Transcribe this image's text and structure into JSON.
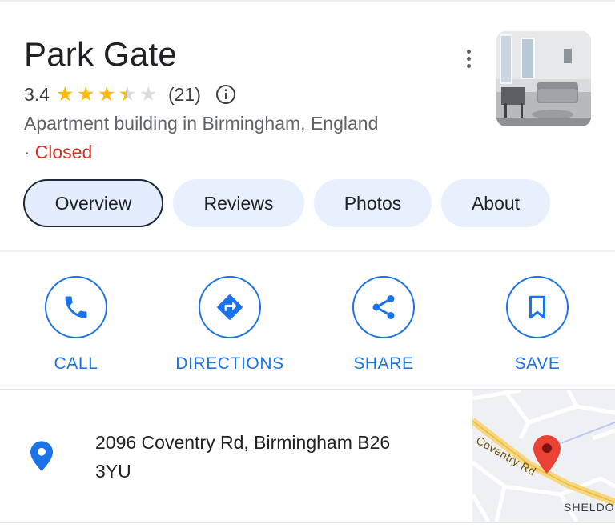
{
  "place": {
    "name": "Park Gate",
    "rating": "3.4",
    "rating_value": 3.4,
    "review_count": "(21)",
    "category": "Apartment building in Birmingham, England",
    "status_separator": "·",
    "status": "Closed"
  },
  "tabs": [
    {
      "label": "Overview",
      "active": true
    },
    {
      "label": "Reviews",
      "active": false
    },
    {
      "label": "Photos",
      "active": false
    },
    {
      "label": "About",
      "active": false
    }
  ],
  "actions": [
    {
      "label": "CALL",
      "icon": "phone-icon"
    },
    {
      "label": "DIRECTIONS",
      "icon": "directions-icon"
    },
    {
      "label": "SHARE",
      "icon": "share-icon"
    },
    {
      "label": "SAVE",
      "icon": "bookmark-icon"
    }
  ],
  "address": {
    "line1": "2096 Coventry Rd, Birmingham B26",
    "line2": "3YU",
    "icon": "location-pin-icon"
  },
  "map": {
    "road_label": "Coventry Rd",
    "area_label": "SHELDO"
  },
  "colors": {
    "accent": "#1a73e8",
    "star": "#fbbc04",
    "closed": "#d93025",
    "tab_bg": "#e8f0fe",
    "map_pin": "#ea4335"
  }
}
